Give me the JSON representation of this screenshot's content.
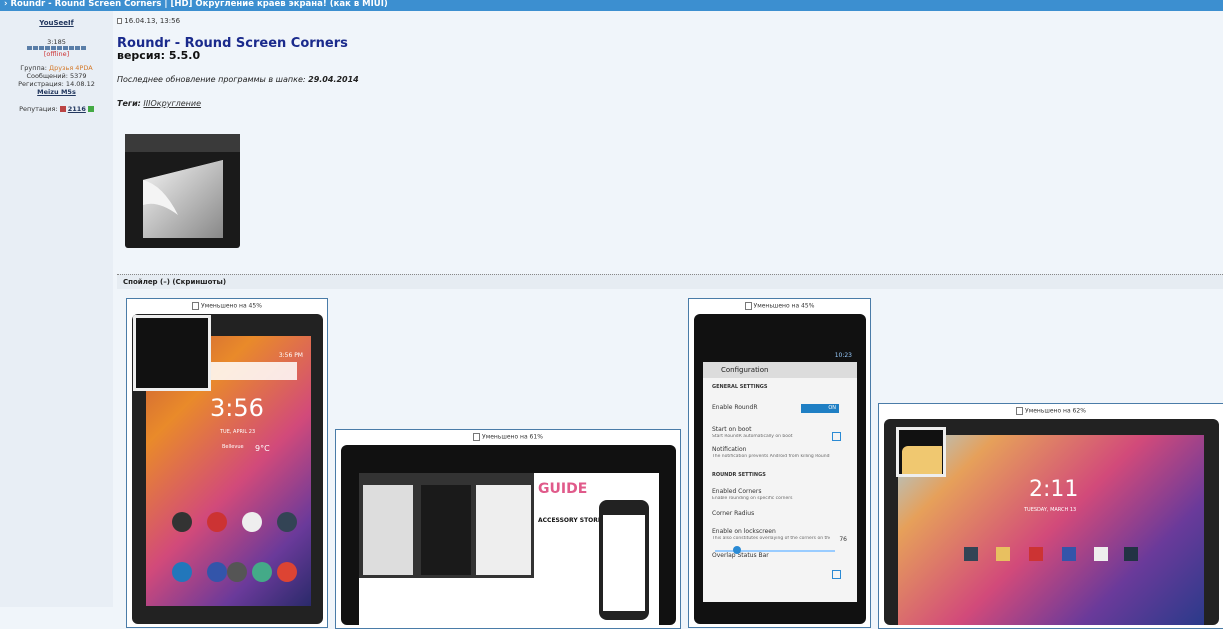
{
  "topbar": {
    "title": "› Roundr - Round Screen Corners | [HD] Округление краев экрана! (как в MIUI)"
  },
  "user": {
    "name": "YouSeeIf",
    "rank": "3:185",
    "status": "[offline]",
    "group_label": "Группа:",
    "group": "Друзья 4PDA",
    "messages": "Сообщений: 5379",
    "registered": "Регистрация: 14.08.12",
    "device": "Meizu M5s",
    "reputation_label": "Репутация:",
    "reputation": "2116"
  },
  "post": {
    "date": "16.04.13, 13:56",
    "app_title": "Roundr - Round Screen Corners",
    "version": "версия: 5.5.0",
    "last_update_label": "Последнее обновление программы в шапке:",
    "last_update": "29.04.2014",
    "tags_label": "Теги:",
    "tag": "IIIОкругление"
  },
  "spoiler": {
    "title": "Спойлер (–) (Скриншоты)",
    "shots": [
      {
        "caption": "Уменьшено на 45%"
      },
      {
        "caption": "Уменьшено на 61%"
      },
      {
        "caption": "Уменьшено на 45%"
      },
      {
        "caption": "Уменьшено на 62%"
      }
    ]
  },
  "phone1": {
    "time": "3:56",
    "status_time": "3:56 PM",
    "date": "TUE, APRIL 23",
    "weather": "Bellevue",
    "temp": "9°C"
  },
  "tablet1": {
    "guide": "GUIDE",
    "store": "ACCESSORY STORE"
  },
  "phone2": {
    "status_time": "10:23",
    "app_bar": "Configuration",
    "rows": [
      {
        "text": "GENERAL SETTINGS"
      },
      {
        "text": "Enable RoundR"
      },
      {
        "text": "Start on boot"
      },
      {
        "text": "Start RoundR automatically on boot"
      },
      {
        "text": "Notification"
      },
      {
        "text": "The notification prevents Android from killing RoundR in low memory situations"
      },
      {
        "text": "ROUNDR SETTINGS"
      },
      {
        "text": "Enabled Corners"
      },
      {
        "text": "Enable rounding on specific corners"
      },
      {
        "text": "Corner Radius"
      },
      {
        "text": "Enable on lockscreen"
      },
      {
        "text": "This also constitutes overlaying of the corners on the notification pull-down"
      },
      {
        "text": "Overlap Status Bar"
      }
    ],
    "toggle": "ON",
    "radius": "76"
  },
  "tablet2": {
    "time": "2:11",
    "date": "TUESDAY, MARCH 13"
  }
}
